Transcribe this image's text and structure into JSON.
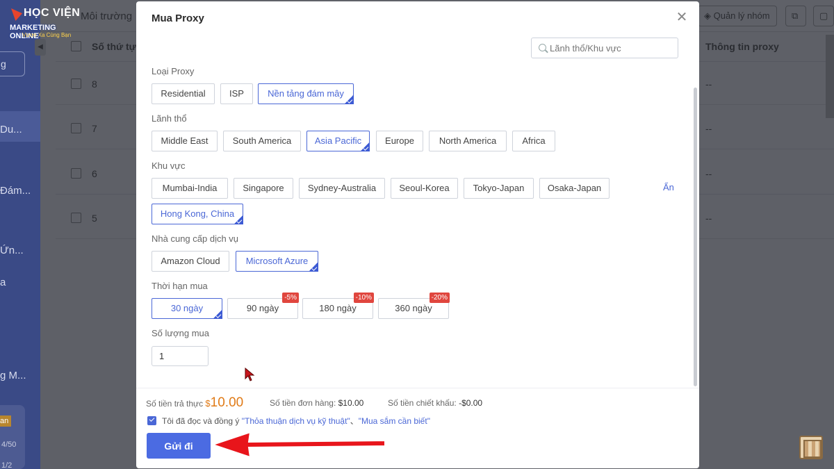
{
  "background": {
    "topbar_title": "Môi trường",
    "group_button": "Quản lý nhóm",
    "col_index": "Số thứ tự",
    "col_proxy_info": "Thông tin proxy",
    "rows": [
      {
        "index": "8",
        "info": "--"
      },
      {
        "index": "7",
        "info": "--"
      },
      {
        "index": "6",
        "info": "--"
      },
      {
        "index": "5",
        "info": "--"
      }
    ],
    "sidebar": {
      "btn": "g",
      "items": [
        "Du...",
        "Đám...",
        "Ứn...",
        "a",
        "g M..."
      ],
      "badge": "an",
      "small1": "4/50",
      "small2": "1/2"
    }
  },
  "logo": {
    "line1": "HỌC VIỆN",
    "line2": "MARKETING ONLINE",
    "line3": "Vươn Xa Cùng Bạn"
  },
  "modal": {
    "title": "Mua Proxy",
    "search_placeholder": "Lãnh thổ/Khu vực",
    "proxy_type": {
      "label": "Loại Proxy",
      "options": [
        "Residential",
        "ISP",
        "Nền tảng đám mây"
      ],
      "selected": "Nền tảng đám mây"
    },
    "territory": {
      "label": "Lãnh thổ",
      "options": [
        "Middle East",
        "South America",
        "Asia Pacific",
        "Europe",
        "North America",
        "Africa"
      ],
      "selected": "Asia Pacific"
    },
    "region": {
      "label": "Khu vực",
      "options": [
        "Mumbai-India",
        "Singapore",
        "Sydney-Australia",
        "Seoul-Korea",
        "Tokyo-Japan",
        "Osaka-Japan",
        "Hong Kong, China"
      ],
      "selected": "Hong Kong, China",
      "toggle": "Ẩn"
    },
    "provider": {
      "label": "Nhà cung cấp dịch vụ",
      "options": [
        "Amazon Cloud",
        "Microsoft Azure"
      ],
      "selected": "Microsoft Azure"
    },
    "duration": {
      "label": "Thời hạn mua",
      "options": [
        {
          "label": "30 ngày",
          "discount": ""
        },
        {
          "label": "90 ngày",
          "discount": "-5%"
        },
        {
          "label": "180 ngày",
          "discount": "-10%"
        },
        {
          "label": "360 ngày",
          "discount": "-20%"
        }
      ],
      "selected": "30 ngày"
    },
    "quantity": {
      "label": "Số lượng mua",
      "value": "1"
    },
    "summary": {
      "pay_label": "Số tiền trả thực",
      "pay_currency": "$",
      "pay_amount": "10.00",
      "order_label": "Số tiền đơn hàng:",
      "order_amount": "$10.00",
      "discount_label": "Số tiền chiết khấu:",
      "discount_amount": "-$0.00"
    },
    "agreement": {
      "checked": true,
      "prefix": "Tôi đã đọc và đồng ý",
      "link1": "\"Thỏa thuận dịch vụ kỹ thuật\"",
      "sep": "、",
      "link2": "\"Mua sắm cần biết\""
    },
    "submit_label": "Gửi đi"
  },
  "colors": {
    "accent": "#4a67d6",
    "price": "#e07a16",
    "discount_badge": "#e0463e",
    "arrow": "#e8151b"
  }
}
